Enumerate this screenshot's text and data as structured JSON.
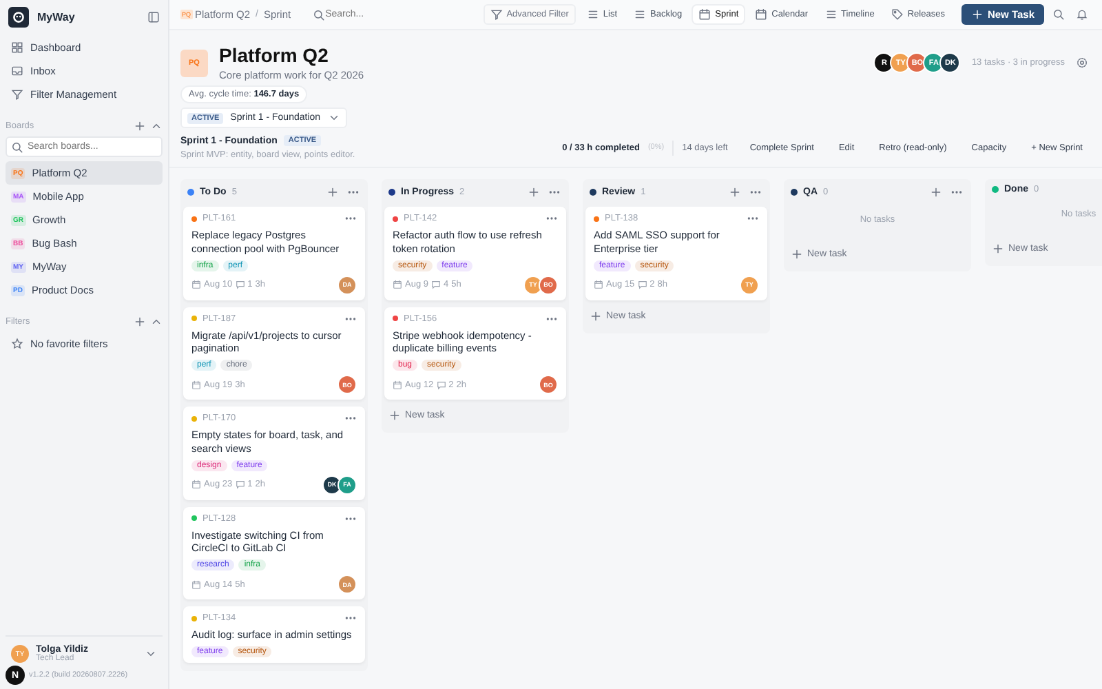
{
  "sidebar": {
    "app_name": "MyWay",
    "nav": [
      {
        "label": "Dashboard",
        "selected": false
      },
      {
        "label": "Inbox",
        "selected": false
      },
      {
        "label": "Filter Management",
        "selected": false
      }
    ],
    "boards_heading": "Boards",
    "boards_search": {
      "placeholder": "Search boards..."
    },
    "boards": [
      {
        "initials": "PQ",
        "label": "Platform Q2",
        "color": "#f97316",
        "selected": true
      },
      {
        "initials": "MA",
        "label": "Mobile App",
        "color": "#a855f7",
        "selected": false
      },
      {
        "initials": "GR",
        "label": "Growth",
        "color": "#22c55e",
        "selected": false
      },
      {
        "initials": "BB",
        "label": "Bug Bash",
        "color": "#ec4899",
        "selected": false
      },
      {
        "initials": "MY",
        "label": "MyWay",
        "color": "#6366f1",
        "selected": false
      },
      {
        "initials": "PD",
        "label": "Product Docs",
        "color": "#3b82f6",
        "selected": false
      }
    ],
    "filters_heading": "Filters",
    "filters_empty": "No favorite filters",
    "user": {
      "initials": "TY",
      "name": "Tolga Yildiz",
      "role": "Tech Lead"
    },
    "version": "v1.2.2 (build 20260807.2226)",
    "dev_badge": "N"
  },
  "topbar": {
    "breadcrumb": [
      {
        "badge": "PQ",
        "label": "Platform Q2"
      },
      {
        "label": "Sprint"
      }
    ],
    "separator": "/",
    "search": {
      "placeholder": "Search..."
    },
    "advanced_filter": "Advanced Filter",
    "views": [
      {
        "label": "List",
        "selected": false
      },
      {
        "label": "Backlog",
        "selected": false
      },
      {
        "label": "Sprint",
        "selected": true
      },
      {
        "label": "Calendar",
        "selected": false
      },
      {
        "label": "Timeline",
        "selected": false
      },
      {
        "label": "Releases",
        "selected": false
      }
    ],
    "new_task": "New Task"
  },
  "board_header": {
    "badge": "PQ",
    "title": "Platform Q2",
    "description": "Core platform work for Q2 2026",
    "members": [
      {
        "initials": "R",
        "color": "#111111"
      },
      {
        "initials": "TY",
        "color": "#f0a050"
      },
      {
        "initials": "BO",
        "color": "#e06a4a"
      },
      {
        "initials": "FA",
        "color": "#1f9e8a"
      },
      {
        "initials": "DK",
        "color": "#1e3a4a"
      }
    ],
    "summary": "13 tasks · 3 in progress",
    "cycle_time": "Avg. cycle time: **146.7 days**",
    "sprint_picker": {
      "status": "ACTIVE",
      "label": "Sprint 1 - Foundation"
    }
  },
  "sprint_bar": {
    "name": "Sprint 1 - Foundation",
    "status": "ACTIVE",
    "goal": "Sprint MVP: entity, board view, points editor.",
    "completed": "0 / 33 h completed",
    "percent": "(0%)",
    "days_left": "14 days left",
    "actions": [
      "Complete Sprint",
      "Edit",
      "Retro (read-only)",
      "Capacity",
      "+ New Sprint"
    ]
  },
  "columns": [
    {
      "name": "To Do",
      "count": "5",
      "color": "#3b82f6",
      "header_buttons": true,
      "cards": [
        {
          "id": "PLT-161",
          "color": "#f97316",
          "title": "Replace legacy Postgres connection pool with PgBouncer",
          "tags": [
            {
              "label": "infra",
              "color": "#16a34a"
            },
            {
              "label": "perf",
              "color": "#0891b2"
            }
          ],
          "date": "Aug 10",
          "comments": "1",
          "hours": "3h",
          "assignees": [
            {
              "initials": "DA",
              "color": "#d4915a"
            }
          ]
        },
        {
          "id": "PLT-187",
          "color": "#eab308",
          "title": "Migrate /api/v1/projects to cursor pagination",
          "tags": [
            {
              "label": "perf",
              "color": "#0891b2"
            },
            {
              "label": "chore",
              "color": "#6b7280"
            }
          ],
          "date": "Aug 19",
          "hours": "3h",
          "assignees": [
            {
              "initials": "BO",
              "color": "#e06a4a"
            }
          ]
        },
        {
          "id": "PLT-170",
          "color": "#eab308",
          "title": "Empty states for board, task, and search views",
          "tags": [
            {
              "label": "design",
              "color": "#db2777"
            },
            {
              "label": "feature",
              "color": "#7c3aed"
            }
          ],
          "date": "Aug 23",
          "comments": "1",
          "hours": "2h",
          "assignees": [
            {
              "initials": "DK",
              "color": "#1e3a4a"
            },
            {
              "initials": "FA",
              "color": "#1f9e8a"
            }
          ]
        },
        {
          "id": "PLT-128",
          "color": "#22c55e",
          "title": "Investigate switching CI from CircleCI to GitLab CI",
          "tags": [
            {
              "label": "research",
              "color": "#4f46e5"
            },
            {
              "label": "infra",
              "color": "#16a34a"
            }
          ],
          "date": "Aug 14",
          "hours": "5h",
          "assignees": [
            {
              "initials": "DA",
              "color": "#d4915a"
            }
          ]
        },
        {
          "id": "PLT-134",
          "color": "#eab308",
          "title": "Audit log: surface in admin settings",
          "tags": [
            {
              "label": "feature",
              "color": "#7c3aed"
            },
            {
              "label": "security",
              "color": "#b45309"
            }
          ]
        }
      ]
    },
    {
      "name": "In Progress",
      "count": "2",
      "color": "#1e3a8a",
      "header_buttons": true,
      "new_task": "New task",
      "cards": [
        {
          "id": "PLT-142",
          "color": "#ef4444",
          "title": "Refactor auth flow to use refresh token rotation",
          "tags": [
            {
              "label": "security",
              "color": "#b45309"
            },
            {
              "label": "feature",
              "color": "#7c3aed"
            }
          ],
          "date": "Aug 9",
          "comments": "4",
          "hours": "5h",
          "assignees": [
            {
              "initials": "TY",
              "color": "#f0a050"
            },
            {
              "initials": "BO",
              "color": "#e06a4a"
            }
          ]
        },
        {
          "id": "PLT-156",
          "color": "#ef4444",
          "title": "Stripe webhook idempotency - duplicate billing events",
          "tags": [
            {
              "label": "bug",
              "color": "#e11d48"
            },
            {
              "label": "security",
              "color": "#b45309"
            }
          ],
          "date": "Aug 12",
          "comments": "2",
          "hours": "2h",
          "assignees": [
            {
              "initials": "BO",
              "color": "#e06a4a"
            }
          ]
        }
      ]
    },
    {
      "name": "Review",
      "count": "1",
      "color": "#1e3a5f",
      "header_buttons": true,
      "new_task": "New task",
      "cards": [
        {
          "id": "PLT-138",
          "color": "#f97316",
          "title": "Add SAML SSO support for Enterprise tier",
          "tags": [
            {
              "label": "feature",
              "color": "#7c3aed"
            },
            {
              "label": "security",
              "color": "#b45309"
            }
          ],
          "date": "Aug 15",
          "comments": "2",
          "hours": "8h",
          "assignees": [
            {
              "initials": "TY",
              "color": "#f0a050"
            }
          ]
        }
      ]
    },
    {
      "name": "QA",
      "count": "0",
      "color": "#1e3a5f",
      "header_buttons": true,
      "empty": "No tasks",
      "new_task": "New task"
    },
    {
      "name": "Done",
      "count": "0",
      "color": "#10b981",
      "empty": "No tasks",
      "new_task": "New task"
    }
  ]
}
